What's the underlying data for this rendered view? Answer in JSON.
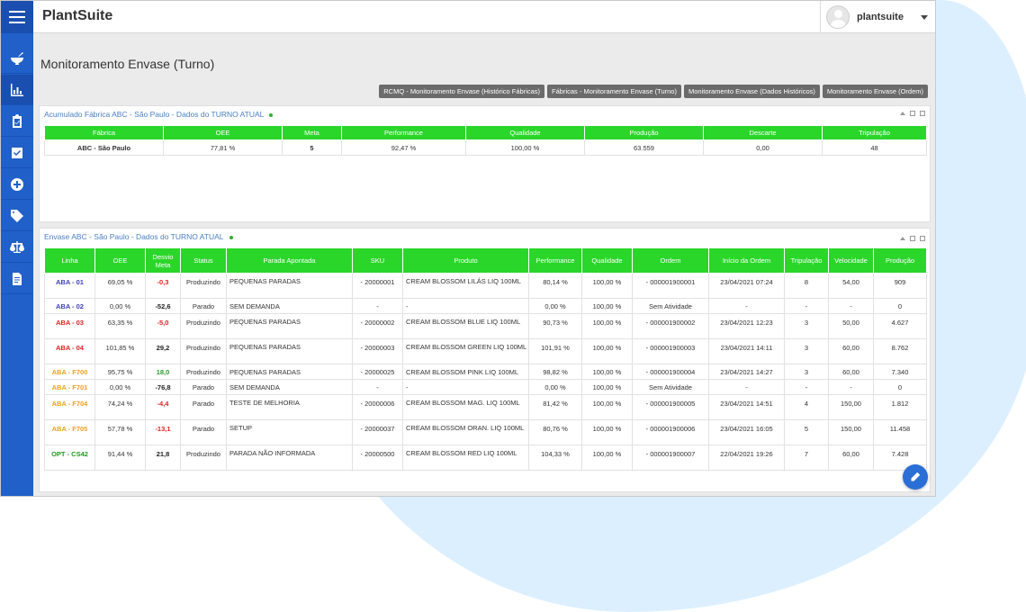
{
  "app": {
    "brand": "PlantSuite",
    "user": "plantsuite"
  },
  "page": {
    "title": "Monitoramento Envase (Turno)"
  },
  "nav_buttons": [
    "RCMQ - Monitoramento Envase (Histórico Fábricas)",
    "Fábricas - Monitoramento Envase (Turno)",
    "Monitoramento Envase (Dados Históricos)",
    "Monitoramento Envase (Ordem)"
  ],
  "sidebar": {
    "icons": [
      "mortar-icon",
      "bar-chart-icon",
      "clipboard-icon",
      "checkbox-icon",
      "add-circle-icon",
      "tag-icon",
      "scale-icon",
      "document-icon"
    ]
  },
  "panel1": {
    "title": "Acumulado Fábrica ABC - São Paulo - Dados do TURNO ATUAL",
    "headers": [
      "Fábrica",
      "OEE",
      "Meta",
      "Performance",
      "Qualidade",
      "Produção",
      "Descarte",
      "Tripulação"
    ],
    "row": [
      "ABC - São Paulo",
      "77,81 %",
      "5",
      "92,47 %",
      "100,00 %",
      "63.559",
      "0,00",
      "48"
    ]
  },
  "panel2": {
    "title": "Envase ABC - São Paulo - Dados do TURNO ATUAL",
    "headers": [
      "Linha",
      "OEE",
      "Desvio Meta",
      "Status",
      "Parada Apontada",
      "SKU",
      "Produto",
      "Performance",
      "Qualidade",
      "Ordem",
      "Início da Ordem",
      "Tripulação",
      "Velocidade",
      "Produção"
    ],
    "rows": [
      {
        "linha": "ABA - 01",
        "lc": "c-blue",
        "oee": "69,05 %",
        "desvio": "-0,3",
        "dc": "c-red",
        "status": "Produzindo",
        "parada": "PEQUENAS PARADAS",
        "sku": "- 20000001",
        "produto": "CREAM BLOSSOM LILÁS LIQ 100ML",
        "perf": "80,14 %",
        "qual": "100,00 %",
        "ordem": "- 000001900001",
        "inicio": "23/04/2021 07:24",
        "trip": "8",
        "vel": "54,00",
        "prod": "909",
        "tall": true
      },
      {
        "linha": "ABA - 02",
        "lc": "c-blue",
        "oee": "0,00 %",
        "desvio": "-52,6",
        "dc": "c-dark",
        "status": "Parado",
        "parada": "SEM DEMANDA",
        "sku": "-",
        "produto": "-",
        "perf": "0,00 %",
        "qual": "100,00 %",
        "ordem": "Sem Atividade",
        "inicio": "-",
        "trip": "-",
        "vel": "-",
        "prod": "0",
        "tall": false
      },
      {
        "linha": "ABA - 03",
        "lc": "c-red",
        "oee": "63,35 %",
        "desvio": "-5,0",
        "dc": "c-red",
        "status": "Produzindo",
        "parada": "PEQUENAS PARADAS",
        "sku": "- 20000002",
        "produto": "CREAM BLOSSOM BLUE LIQ 100ML",
        "perf": "90,73 %",
        "qual": "100,00 %",
        "ordem": "- 000001900002",
        "inicio": "23/04/2021 12:23",
        "trip": "3",
        "vel": "50,00",
        "prod": "4.627",
        "tall": true
      },
      {
        "linha": "ABA - 04",
        "lc": "c-red",
        "oee": "101,85 %",
        "desvio": "29,2",
        "dc": "c-dark",
        "status": "Produzindo",
        "parada": "PEQUENAS PARADAS",
        "sku": "- 20000003",
        "produto": "CREAM BLOSSOM GREEN LIQ 100ML",
        "perf": "101,91 %",
        "qual": "100,00 %",
        "ordem": "- 000001900003",
        "inicio": "23/04/2021 14:11",
        "trip": "3",
        "vel": "60,00",
        "prod": "8.762",
        "tall": true
      },
      {
        "linha": "ABA - F700",
        "lc": "c-orange",
        "oee": "95,75 %",
        "desvio": "18,0",
        "dc": "c-pos",
        "status": "Produzindo",
        "parada": "PEQUENAS PARADAS",
        "sku": "- 20000025",
        "produto": "CREAM BLOSSOM PINK LIQ 100ML",
        "perf": "98,82 %",
        "qual": "100,00 %",
        "ordem": "- 000001900004",
        "inicio": "23/04/2021 14:27",
        "trip": "3",
        "vel": "60,00",
        "prod": "7.340",
        "tall": false
      },
      {
        "linha": "ABA - F701",
        "lc": "c-orange",
        "oee": "0,00 %",
        "desvio": "-76,8",
        "dc": "c-dark",
        "status": "Parado",
        "parada": "SEM DEMANDA",
        "sku": "-",
        "produto": "-",
        "perf": "0,00 %",
        "qual": "100,00 %",
        "ordem": "Sem Atividade",
        "inicio": "-",
        "trip": "-",
        "vel": "-",
        "prod": "0",
        "tall": false
      },
      {
        "linha": "ABA - F704",
        "lc": "c-orange",
        "oee": "74,24 %",
        "desvio": "-4,4",
        "dc": "c-red",
        "status": "Parado",
        "parada": "TESTE DE MELHORIA",
        "sku": "- 20000006",
        "produto": "CREAM BLOSSOM MAG. LIQ 100ML",
        "perf": "81,42 %",
        "qual": "100,00 %",
        "ordem": "- 000001900005",
        "inicio": "23/04/2021 14:51",
        "trip": "4",
        "vel": "150,00",
        "prod": "1.812",
        "tall": true
      },
      {
        "linha": "ABA - F705",
        "lc": "c-orange",
        "oee": "57,78 %",
        "desvio": "-13,1",
        "dc": "c-red",
        "status": "Parado",
        "parada": "SETUP",
        "sku": "- 20000037",
        "produto": "CREAM BLOSSOM ORAN. LIQ 100ML",
        "perf": "80,76 %",
        "qual": "100,00 %",
        "ordem": "- 000001900006",
        "inicio": "23/04/2021 16:05",
        "trip": "5",
        "vel": "150,00",
        "prod": "11.458",
        "tall": true
      },
      {
        "linha": "OPT - CS42",
        "lc": "c-green",
        "oee": "91,44 %",
        "desvio": "21,8",
        "dc": "c-dark",
        "status": "Produzindo",
        "parada": "PARADA NÃO INFORMADA",
        "sku": "- 20000500",
        "produto": "CREAM BLOSSOM RED LIQ 100ML",
        "perf": "104,33 %",
        "qual": "100,00 %",
        "ordem": "- 000001900007",
        "inicio": "22/04/2021 19:26",
        "trip": "7",
        "vel": "60,00",
        "prod": "7.428",
        "tall": true
      }
    ]
  }
}
